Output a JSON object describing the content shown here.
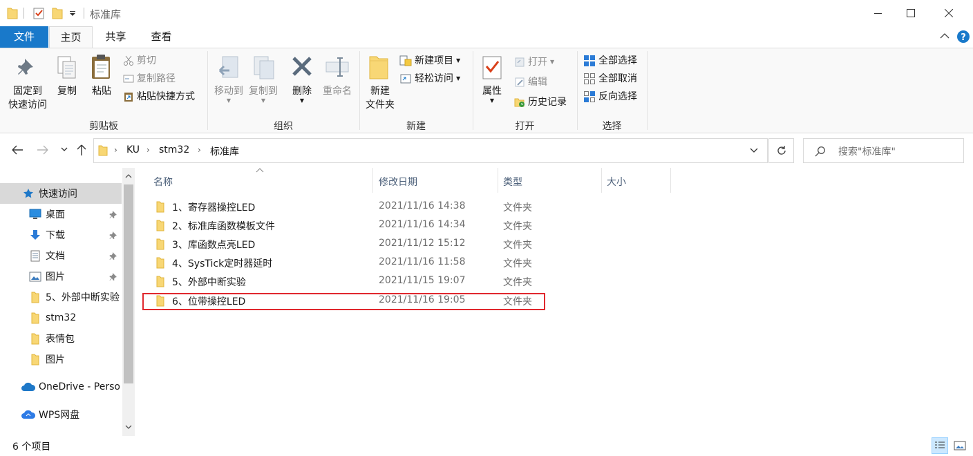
{
  "window": {
    "title": "标准库"
  },
  "ribbon_tabs": [
    "文件",
    "主页",
    "共享",
    "查看"
  ],
  "ribbon": {
    "clipboard": {
      "label": "剪贴板",
      "pin_line1": "固定到",
      "pin_line2": "快速访问",
      "copy": "复制",
      "paste": "粘贴",
      "cut": "剪切",
      "copy_path": "复制路径",
      "paste_shortcut": "粘贴快捷方式"
    },
    "organize": {
      "label": "组织",
      "move_to": "移动到",
      "copy_to": "复制到",
      "delete": "删除",
      "rename": "重命名"
    },
    "new": {
      "label": "新建",
      "new_folder_line1": "新建",
      "new_folder_line2": "文件夹",
      "new_item": "新建项目",
      "easy_access": "轻松访问"
    },
    "open": {
      "label": "打开",
      "properties": "属性",
      "open": "打开",
      "edit": "编辑",
      "history": "历史记录"
    },
    "select": {
      "label": "选择",
      "select_all": "全部选择",
      "select_none": "全部取消",
      "invert": "反向选择"
    }
  },
  "address": {
    "path": [
      "KU",
      "stm32",
      "标准库"
    ],
    "search_placeholder": "搜索\"标准库\""
  },
  "nav": {
    "quick_access": "快速访问",
    "items": [
      {
        "label": "桌面",
        "pinned": true,
        "icon": "desktop-icon"
      },
      {
        "label": "下载",
        "pinned": true,
        "icon": "download-icon"
      },
      {
        "label": "文档",
        "pinned": true,
        "icon": "document-icon"
      },
      {
        "label": "图片",
        "pinned": true,
        "icon": "picture-icon"
      },
      {
        "label": "5、外部中断实验",
        "pinned": false,
        "icon": "folder-icon"
      },
      {
        "label": "stm32",
        "pinned": false,
        "icon": "folder-icon"
      },
      {
        "label": "表情包",
        "pinned": false,
        "icon": "folder-icon"
      },
      {
        "label": "图片",
        "pinned": false,
        "icon": "folder-icon"
      }
    ],
    "onedrive": "OneDrive - Perso",
    "wps": "WPS网盘"
  },
  "columns": {
    "name": "名称",
    "date": "修改日期",
    "type": "类型",
    "size": "大小"
  },
  "files": [
    {
      "name": "1、寄存器操控LED",
      "date": "2021/11/16 14:38",
      "type": "文件夹"
    },
    {
      "name": "2、标准库函数模板文件",
      "date": "2021/11/16 14:34",
      "type": "文件夹"
    },
    {
      "name": "3、库函数点亮LED",
      "date": "2021/11/12 15:12",
      "type": "文件夹"
    },
    {
      "name": "4、SysTick定时器延时",
      "date": "2021/11/16 11:58",
      "type": "文件夹"
    },
    {
      "name": "5、外部中断实验",
      "date": "2021/11/15 19:07",
      "type": "文件夹"
    },
    {
      "name": "6、位带操控LED",
      "date": "2021/11/16 19:05",
      "type": "文件夹"
    }
  ],
  "status": {
    "count": "6 个项目"
  },
  "colors": {
    "accent": "#1979ca",
    "folder": "#f8d775",
    "highlight": "#e0282e"
  }
}
